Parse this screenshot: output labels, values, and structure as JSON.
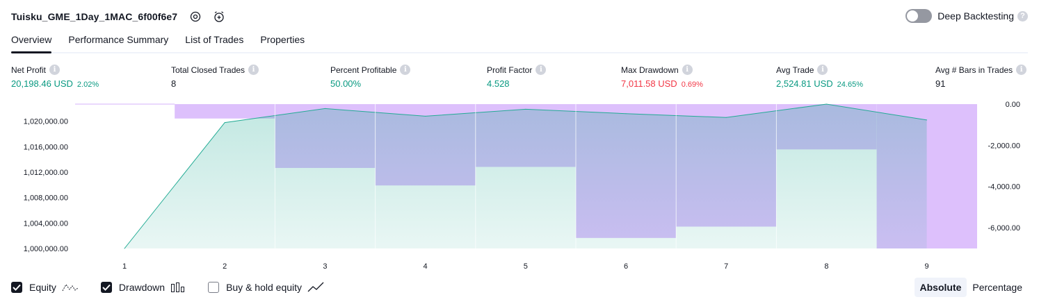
{
  "header": {
    "title": "Tuisku_GME_1Day_1MAC_6f00f6e7",
    "deep_backtesting_label": "Deep Backtesting",
    "help_glyph": "?"
  },
  "tabs": [
    {
      "label": "Overview",
      "active": true
    },
    {
      "label": "Performance Summary",
      "active": false
    },
    {
      "label": "List of Trades",
      "active": false
    },
    {
      "label": "Properties",
      "active": false
    }
  ],
  "metrics": {
    "info_glyph": "i",
    "net_profit": {
      "label": "Net Profit",
      "value": "20,198.46 USD",
      "pct": "2.02%"
    },
    "total_closed_trades": {
      "label": "Total Closed Trades",
      "value": "8"
    },
    "percent_profitable": {
      "label": "Percent Profitable",
      "value": "50.00%"
    },
    "profit_factor": {
      "label": "Profit Factor",
      "value": "4.528"
    },
    "max_drawdown": {
      "label": "Max Drawdown",
      "value": "7,011.58 USD",
      "pct": "0.69%"
    },
    "avg_trade": {
      "label": "Avg Trade",
      "value": "2,524.81 USD",
      "pct": "24.65%"
    },
    "avg_bars": {
      "label": "Avg # Bars in Trades",
      "value": "91"
    }
  },
  "colors": {
    "green": "#089981",
    "red": "#f23645",
    "equity_line": "#22ab94",
    "drawdown_fill": "#d5b2fb"
  },
  "chart_data": {
    "type": "area",
    "x": [
      1,
      2,
      3,
      4,
      5,
      6,
      7,
      8,
      9
    ],
    "x_tick_labels": [
      "1",
      "2",
      "3",
      "4",
      "5",
      "6",
      "7",
      "8",
      "9"
    ],
    "series": [
      {
        "name": "Equity",
        "type": "area",
        "axis": "left",
        "values": [
          1000000,
          1019800,
          1022000,
          1020800,
          1021900,
          1021200,
          1020600,
          1022700,
          1020200
        ]
      },
      {
        "name": "Drawdown",
        "type": "bar",
        "axis": "right",
        "values": [
          0,
          -700,
          -3100,
          -3950,
          -3050,
          -6500,
          -5950,
          -2200,
          -7011.58
        ]
      }
    ],
    "left_axis": {
      "ylim": [
        1000000,
        1022700
      ],
      "ticks": [
        1000000,
        1004000,
        1008000,
        1012000,
        1016000,
        1020000
      ],
      "tick_labels": [
        "1,000,000.00",
        "1,004,000.00",
        "1,008,000.00",
        "1,012,000.00",
        "1,016,000.00",
        "1,020,000.00"
      ]
    },
    "right_axis": {
      "ylim": [
        -7011.58,
        0
      ],
      "ticks": [
        0,
        -2000,
        -4000,
        -6000
      ],
      "tick_labels": [
        "0.00",
        "-2,000.00",
        "-4,000.00",
        "-6,000.00"
      ]
    },
    "grid": false,
    "legend": "bottom-left"
  },
  "footer": {
    "legend": [
      {
        "label": "Equity",
        "checked": true
      },
      {
        "label": "Drawdown",
        "checked": true
      },
      {
        "label": "Buy & hold equity",
        "checked": false
      }
    ],
    "mode_buttons": [
      {
        "label": "Absolute",
        "active": true
      },
      {
        "label": "Percentage",
        "active": false
      }
    ]
  }
}
